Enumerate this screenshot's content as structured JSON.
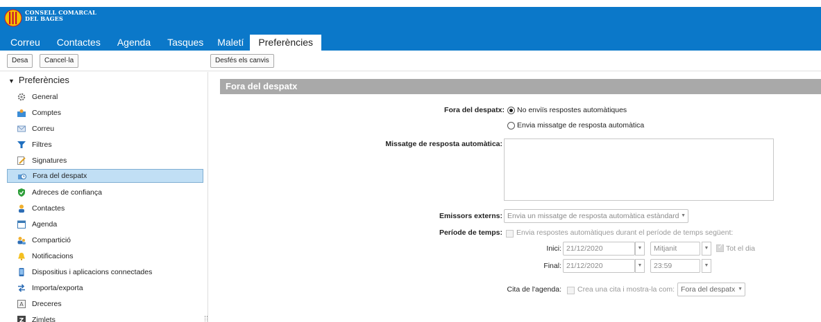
{
  "brand": {
    "line1": "Consell Comarcal",
    "line2": "del Bages"
  },
  "tabs": [
    "Correu",
    "Contactes",
    "Agenda",
    "Tasques",
    "Maletí",
    "Preferències"
  ],
  "toolbar": {
    "save": "Desa",
    "cancel": "Cancel·la",
    "undo": "Desfés els canvis"
  },
  "sidebar": {
    "root": "Preferències",
    "items": [
      {
        "label": "General",
        "icon": "gear-icon"
      },
      {
        "label": "Comptes",
        "icon": "accounts-icon"
      },
      {
        "label": "Correu",
        "icon": "envelope-icon"
      },
      {
        "label": "Filtres",
        "icon": "filter-icon"
      },
      {
        "label": "Signatures",
        "icon": "signature-icon"
      },
      {
        "label": "Fora del despatx",
        "icon": "out-of-office-icon"
      },
      {
        "label": "Adreces de confiança",
        "icon": "shield-check-icon"
      },
      {
        "label": "Contactes",
        "icon": "contact-icon"
      },
      {
        "label": "Agenda",
        "icon": "calendar-icon"
      },
      {
        "label": "Compartició",
        "icon": "sharing-icon"
      },
      {
        "label": "Notificacions",
        "icon": "bell-icon"
      },
      {
        "label": "Dispositius i aplicacions connectades",
        "icon": "device-icon"
      },
      {
        "label": "Importa/exporta",
        "icon": "import-export-icon"
      },
      {
        "label": "Dreceres",
        "icon": "shortcut-icon"
      },
      {
        "label": "Zimlets",
        "icon": "zimlet-icon"
      }
    ],
    "selected": "Fora del despatx"
  },
  "main": {
    "section_title": "Fora del despatx",
    "ooo_label": "Fora del despatx:",
    "radio_off": "No enviïs respostes automàtiques",
    "radio_on": "Envia missatge de resposta automàtica",
    "message_label": "Missatge de resposta automàtica:",
    "external_label": "Emissors externs:",
    "external_value": "Envia un missatge de resposta automàtica estàndard",
    "period_label": "Període de temps:",
    "period_check": "Envia respostes automàtiques durant el període de temps següent:",
    "start_label": "Inici:",
    "start_date": "21/12/2020",
    "start_time": "Mitjanit",
    "all_day": "Tot el dia",
    "end_label": "Final:",
    "end_date": "21/12/2020",
    "end_time": "23:59",
    "cal_label": "Cita de l'agenda:",
    "cal_check": "Crea una cita i mostra-la com:",
    "cal_value": "Fora del despatx"
  },
  "colors": {
    "header": "#0b78c9",
    "section": "#a9a9a9",
    "selected": "#c1dff5"
  }
}
